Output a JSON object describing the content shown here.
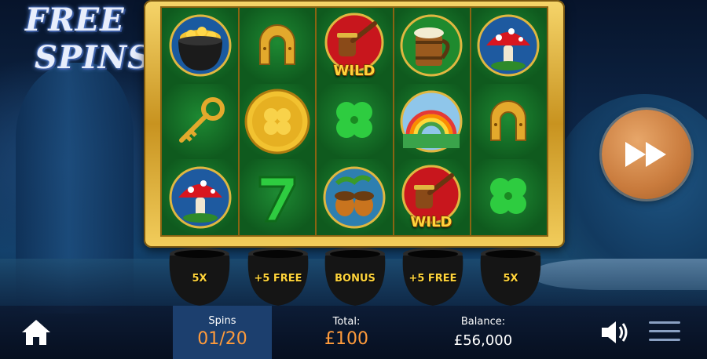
{
  "logo": {
    "line1": "FREE",
    "line2": "SPINS"
  },
  "reels": {
    "rows": [
      [
        "pot-of-gold",
        "horseshoe",
        "pipe-wild",
        "beer-tankard",
        "mushroom"
      ],
      [
        "golden-key",
        "gold-clover-coin",
        "four-leaf-clover",
        "rainbow",
        "horseshoe"
      ],
      [
        "mushroom",
        "lucky-seven",
        "acorns",
        "pipe-wild",
        "four-leaf-clover"
      ]
    ],
    "wild_text": "WILD"
  },
  "pots": [
    "5X",
    "+5 FREE",
    "BONUS",
    "+5 FREE",
    "5X"
  ],
  "bottom_bar": {
    "spins_label": "Spins",
    "spins_value": "01/20",
    "total_label": "Total:",
    "total_value": "£100",
    "balance_label": "Balance:",
    "balance_value": "£56,000"
  },
  "colors": {
    "accent_orange": "#ff9b3b",
    "gold": "#ffd43b",
    "felt_green": "#0f5a1e",
    "turbo_button": "#c97b3d"
  },
  "icons": {
    "home": "home-icon",
    "sound": "speaker-icon",
    "menu": "hamburger-menu-icon",
    "turbo": "fast-forward-icon"
  }
}
